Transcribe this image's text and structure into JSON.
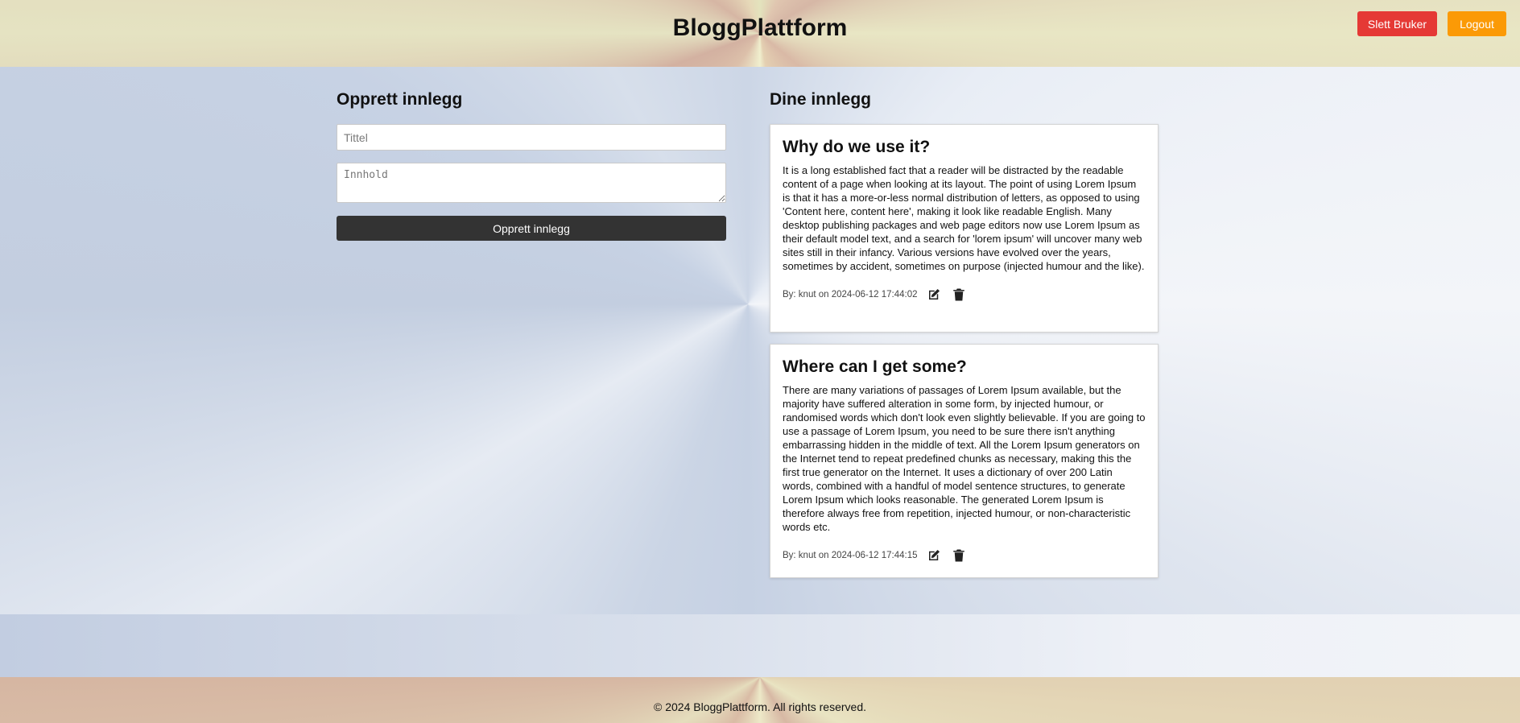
{
  "header": {
    "title": "BloggPlattform",
    "delete_user_label": "Slett Bruker",
    "logout_label": "Logout"
  },
  "create": {
    "heading": "Opprett innlegg",
    "title_placeholder": "Tittel",
    "content_placeholder": "Innhold",
    "submit_label": "Opprett innlegg"
  },
  "posts": {
    "heading": "Dine innlegg",
    "items": [
      {
        "title": "Why do we use it?",
        "body": "It is a long established fact that a reader will be distracted by the readable content of a page when looking at its layout. The point of using Lorem Ipsum is that it has a more-or-less normal distribution of letters, as opposed to using 'Content here, content here', making it look like readable English. Many desktop publishing packages and web page editors now use Lorem Ipsum as their default model text, and a search for 'lorem ipsum' will uncover many web sites still in their infancy. Various versions have evolved over the years, sometimes by accident, sometimes on purpose (injected humour and the like).",
        "meta": "By: knut on 2024-06-12 17:44:02",
        "edit_icon": "edit-icon",
        "delete_icon": "trash-icon"
      },
      {
        "title": "Where can I get some?",
        "body": "There are many variations of passages of Lorem Ipsum available, but the majority have suffered alteration in some form, by injected humour, or randomised words which don't look even slightly believable. If you are going to use a passage of Lorem Ipsum, you need to be sure there isn't anything embarrassing hidden in the middle of text. All the Lorem Ipsum generators on the Internet tend to repeat predefined chunks as necessary, making this the first true generator on the Internet. It uses a dictionary of over 200 Latin words, combined with a handful of model sentence structures, to generate Lorem Ipsum which looks reasonable. The generated Lorem Ipsum is therefore always free from repetition, injected humour, or non-characteristic words etc.",
        "meta": "By: knut on 2024-06-12 17:44:15",
        "edit_icon": "edit-icon",
        "delete_icon": "trash-icon"
      }
    ]
  },
  "footer": {
    "text": "© 2024 BloggPlattform. All rights reserved."
  },
  "colors": {
    "delete_user": "#e53935",
    "logout": "#fb9a06",
    "create_button": "#333333"
  }
}
